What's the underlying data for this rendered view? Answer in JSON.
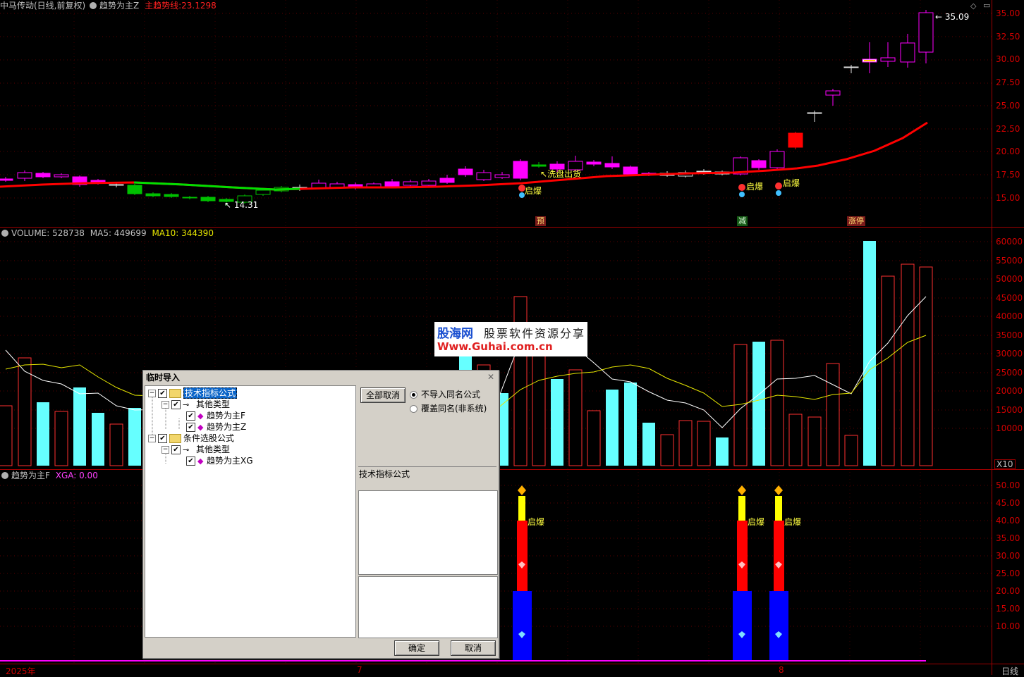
{
  "header_main": {
    "stock": "中马传动(日线,前复权)",
    "indicator": "趋势为主Z",
    "line_label": "主趋势线:",
    "line_value": "23.1298"
  },
  "header_volume": {
    "volume": "VOLUME: 528738",
    "ma5": "MA5: 449699",
    "ma10": "MA10: 344390"
  },
  "header_sub": {
    "name": "趋势为主F",
    "xga": "XGA: 0.00"
  },
  "price_axis": [
    "35.00",
    "32.50",
    "30.00",
    "27.50",
    "25.00",
    "22.50",
    "20.00",
    "17.50",
    "15.00"
  ],
  "volume_axis": [
    "60000",
    "55000",
    "50000",
    "45000",
    "40000",
    "35000",
    "30000",
    "25000",
    "20000",
    "15000",
    "10000"
  ],
  "volume_unit": "X10",
  "sub_axis": [
    "50.00",
    "45.00",
    "40.00",
    "35.00",
    "30.00",
    "25.00",
    "20.00",
    "15.00",
    "10.00"
  ],
  "price_annotations": {
    "high": "35.09",
    "low": "14.31",
    "wash": "洗盘出货",
    "signals": [
      "启爆",
      "启爆",
      "启爆"
    ],
    "tags": [
      "预",
      "减",
      "涨停"
    ]
  },
  "sub_annotations": [
    "启爆",
    "启爆",
    "启爆"
  ],
  "time_axis": {
    "year": "2025年",
    "m7": "7",
    "m8": "8",
    "period": "日线"
  },
  "watermark": {
    "brand": "股海网",
    "slogan": "股票软件资源分享",
    "url": "Www.Guhai.com.cn"
  },
  "dialog": {
    "title": "临时导入",
    "tree": {
      "node1": "技术指标公式",
      "node1_child": "其他类型",
      "leaf1": "趋势为主F",
      "leaf2": "趋势为主Z",
      "node2": "条件选股公式",
      "node2_child": "其他类型",
      "leaf3": "趋势为主XG"
    },
    "cancel_all": "全部取消",
    "radio1": "不导入同名公式",
    "radio2": "覆盖同名(非系统)",
    "category_label": "技术指标公式",
    "ok": "确定",
    "cancel": "取消"
  },
  "colors": {
    "up": "#ff00ff",
    "down": "#00c000",
    "trend": "#ff0000",
    "volume_down": "#66ffff",
    "axis": "#d00000"
  }
}
